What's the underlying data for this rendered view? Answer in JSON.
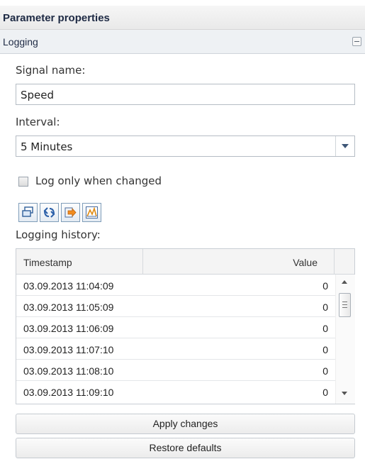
{
  "panel": {
    "title": "Parameter properties"
  },
  "section": {
    "title": "Logging"
  },
  "signal": {
    "label": "Signal name:",
    "value": "Speed"
  },
  "interval": {
    "label": "Interval:",
    "value": "5 Minutes"
  },
  "checkbox": {
    "label": "Log only when changed",
    "checked": false
  },
  "toolbar": {
    "icons": [
      "window-icon",
      "refresh-icon",
      "export-icon",
      "chart-icon"
    ]
  },
  "history": {
    "label": "Logging history:",
    "columns": [
      "Timestamp",
      "Value"
    ],
    "rows": [
      {
        "timestamp": "03.09.2013 11:04:09",
        "value": "0"
      },
      {
        "timestamp": "03.09.2013 11:05:09",
        "value": "0"
      },
      {
        "timestamp": "03.09.2013 11:06:09",
        "value": "0"
      },
      {
        "timestamp": "03.09.2013 11:07:10",
        "value": "0"
      },
      {
        "timestamp": "03.09.2013 11:08:10",
        "value": "0"
      },
      {
        "timestamp": "03.09.2013 11:09:10",
        "value": "0"
      }
    ]
  },
  "buttons": {
    "apply": "Apply changes",
    "restore": "Restore defaults"
  }
}
